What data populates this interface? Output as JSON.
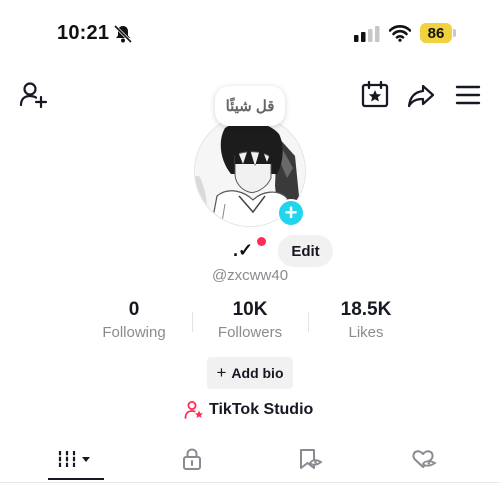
{
  "status_bar": {
    "time": "10:21",
    "battery_level": "86",
    "icons": [
      "bell-muted-icon",
      "cellular-signal-icon",
      "wifi-icon",
      "battery-icon"
    ],
    "battery_color": "#f2d23c"
  },
  "header": {
    "icons": [
      "add-friend-icon",
      "calendar-star-icon",
      "share-icon",
      "menu-icon"
    ]
  },
  "profile": {
    "bubble_text": "قل شيئًا",
    "nickname": ".✓",
    "edit_label": "Edit",
    "username": "@zxcww40",
    "add_bio_label": "Add bio",
    "studio_label": "TikTok Studio",
    "accent_color": "#20d5ec",
    "notify_color": "#fe2c55"
  },
  "stats": [
    {
      "value": "0",
      "label": "Following"
    },
    {
      "value": "10K",
      "label": "Followers"
    },
    {
      "value": "18.5K",
      "label": "Likes"
    }
  ],
  "tabs": [
    {
      "icon": "videos-grid-icon",
      "active": true
    },
    {
      "icon": "lock-icon",
      "active": false
    },
    {
      "icon": "favorites-icon",
      "active": false
    },
    {
      "icon": "liked-heart-icon",
      "active": false
    }
  ]
}
